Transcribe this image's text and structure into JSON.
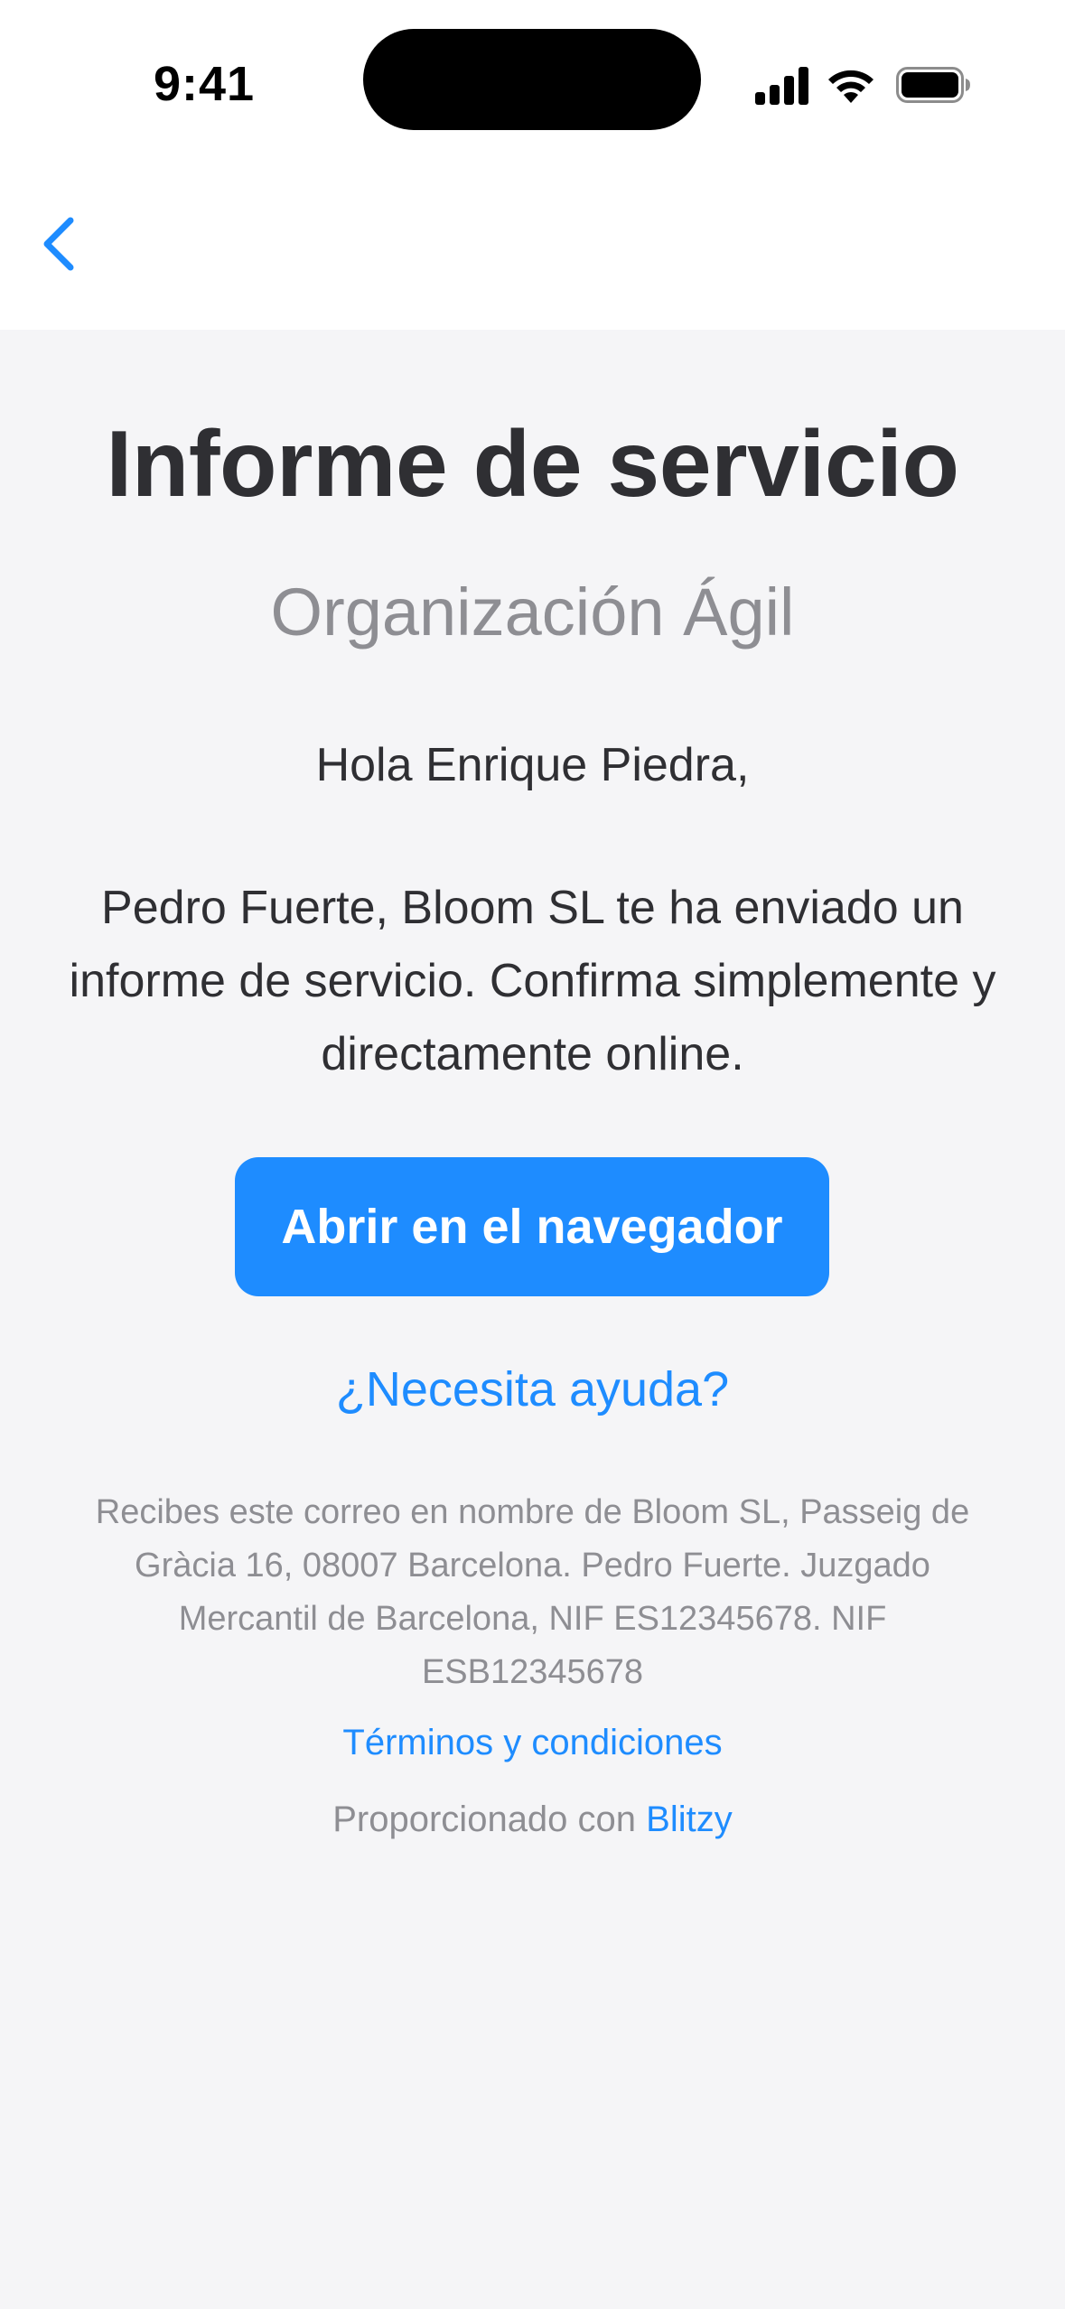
{
  "status_bar": {
    "time": "9:41",
    "icons": [
      "cellular-signal-icon",
      "wifi-icon",
      "battery-icon"
    ]
  },
  "nav": {
    "back_icon": "chevron-left-icon"
  },
  "email": {
    "title": "Informe de servicio",
    "organization": "Organización Ágil",
    "greeting": "Hola Enrique Piedra,",
    "message": "Pedro Fuerte, Bloom SL te ha enviado un informe de servicio. Confirma simplemente y directamente online.",
    "open_button_label": "Abrir en el navegador",
    "help_link": "¿Necesita ayuda?",
    "footer_text": "Recibes este correo en nombre de Bloom SL, Passeig de Gràcia 16, 08007 Barcelona. Pedro Fuerte. Juzgado Mercantil de Barcelona, NIF ES12345678. NIF ESB12345678",
    "terms_link": "Términos y condiciones",
    "powered_prefix": "Proporcionado con",
    "powered_brand": "Blitzy"
  },
  "colors": {
    "accent": "#1e8cff",
    "text_primary": "#2f2f33",
    "text_secondary": "#8e8e93",
    "background": "#f5f5f7"
  }
}
